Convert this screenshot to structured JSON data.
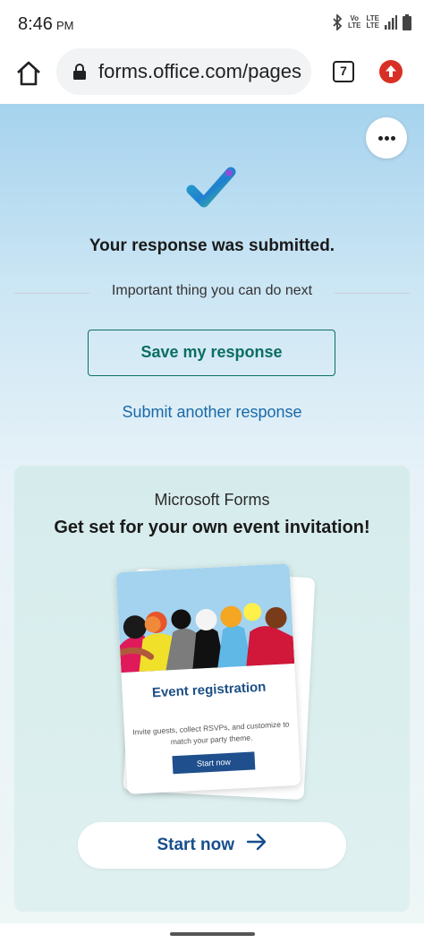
{
  "status_bar": {
    "time": "8:46",
    "ampm": "PM",
    "network_top": "Vo",
    "network_bottom": "LTE",
    "network2_top": "LTE",
    "network2_bottom": "LTE"
  },
  "browser": {
    "url": "forms.office.com/pages",
    "tab_count": "7"
  },
  "confirmation": {
    "title": "Your response was submitted.",
    "next_label": "Important thing you can do next",
    "save_button": "Save my response",
    "submit_another": "Submit another response"
  },
  "promo": {
    "brand": "Microsoft Forms",
    "title": "Get set for your own event invitation!",
    "illustration": {
      "heading": "Event registration",
      "description": "Invite guests, collect RSVPs, and customize to match your party theme.",
      "button": "Start now"
    },
    "start_button": "Start now"
  },
  "colors": {
    "accent_teal": "#0b6e63",
    "link_blue": "#1a6aa8",
    "start_blue": "#174e8c",
    "update_red": "#d93025"
  }
}
